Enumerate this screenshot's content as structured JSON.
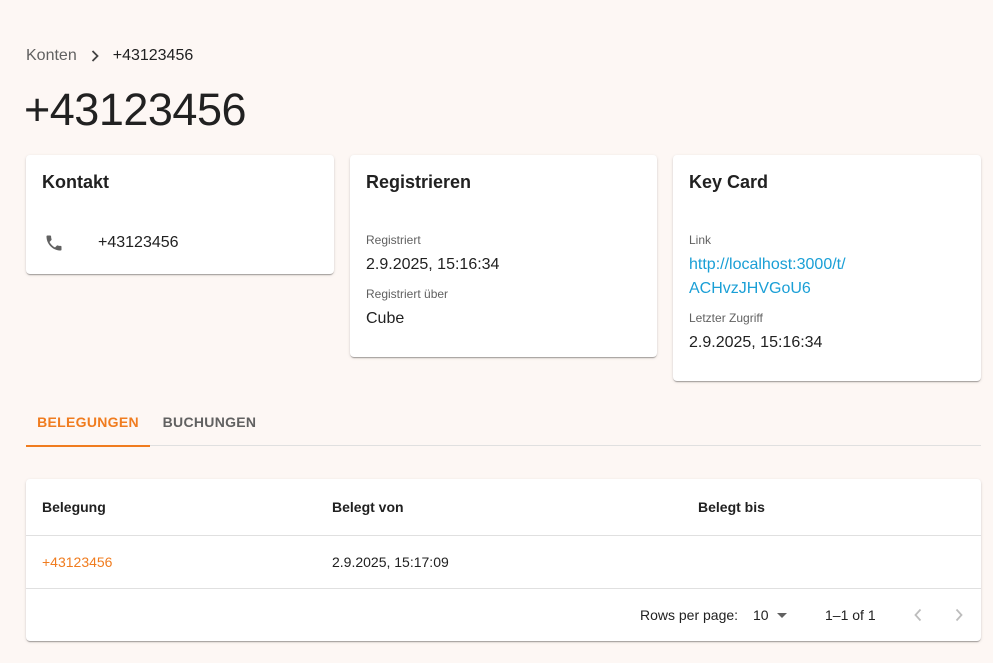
{
  "breadcrumb": {
    "parent": "Konten",
    "current": "+43123456"
  },
  "page_title": "+43123456",
  "kontakt": {
    "title": "Kontakt",
    "phone_icon": "phone-icon",
    "phone": "+43123456"
  },
  "registrieren": {
    "title": "Registrieren",
    "registered_label": "Registriert",
    "registered_value": "2.9.2025, 15:16:34",
    "via_label": "Registriert über",
    "via_value": "Cube"
  },
  "keycard": {
    "title": "Key Card",
    "link_label": "Link",
    "link_line1": "http://localhost:3000/t/",
    "link_line2": "ACHvzJHVGoU6",
    "last_access_label": "Letzter Zugriff",
    "last_access_value": "2.9.2025, 15:16:34"
  },
  "tabs": [
    {
      "label": "BELEGUNGEN",
      "active": true
    },
    {
      "label": "BUCHUNGEN",
      "active": false
    }
  ],
  "table": {
    "columns": [
      "Belegung",
      "Belegt von",
      "Belegt bis"
    ],
    "rows": [
      {
        "belegung": "+43123456",
        "belegt_von": "2.9.2025, 15:17:09",
        "belegt_bis": ""
      }
    ],
    "pagination": {
      "rows_per_page_label": "Rows per page:",
      "rows_per_page_value": "10",
      "range": "1–1 of 1"
    }
  },
  "colors": {
    "accent": "#f07c1f",
    "link": "#1a9fd6",
    "background": "#fdf7f4"
  }
}
